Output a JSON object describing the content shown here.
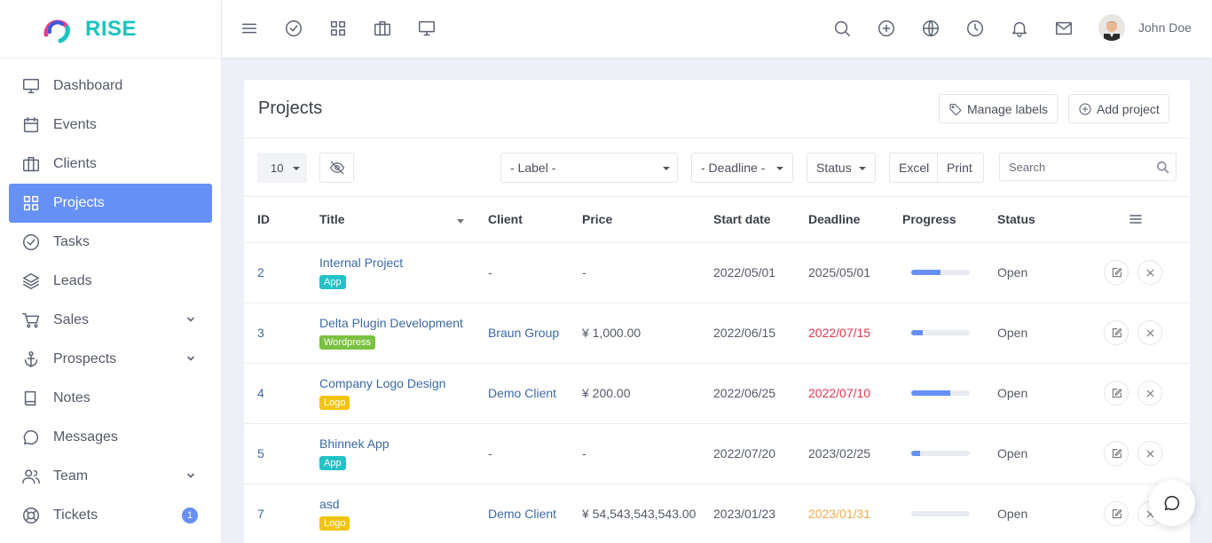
{
  "brand": {
    "name": "RISE"
  },
  "sidebar": {
    "items": [
      {
        "label": "Dashboard",
        "icon": "monitor-icon"
      },
      {
        "label": "Events",
        "icon": "calendar-icon"
      },
      {
        "label": "Clients",
        "icon": "briefcase-icon"
      },
      {
        "label": "Projects",
        "icon": "grid-icon",
        "active": true
      },
      {
        "label": "Tasks",
        "icon": "check-circle-icon"
      },
      {
        "label": "Leads",
        "icon": "layers-icon"
      },
      {
        "label": "Sales",
        "icon": "cart-icon",
        "expandable": true
      },
      {
        "label": "Prospects",
        "icon": "anchor-icon",
        "expandable": true
      },
      {
        "label": "Notes",
        "icon": "book-icon"
      },
      {
        "label": "Messages",
        "icon": "chat-icon"
      },
      {
        "label": "Team",
        "icon": "users-icon",
        "expandable": true
      },
      {
        "label": "Tickets",
        "icon": "lifebuoy-icon",
        "badge": "1"
      }
    ]
  },
  "topbar": {
    "user_name": "John Doe",
    "left_icons": [
      "menu-icon",
      "check-circle-icon",
      "grid-icon",
      "briefcase-icon",
      "monitor-icon"
    ],
    "right_icons": [
      "search-icon",
      "plus-circle-icon",
      "globe-icon",
      "clock-icon",
      "bell-icon",
      "mail-icon"
    ]
  },
  "page": {
    "title": "Projects",
    "manage_labels": "Manage labels",
    "add_project": "Add project"
  },
  "toolbar": {
    "page_size": "10",
    "label_filter": "- Label -",
    "deadline_filter": "- Deadline -",
    "status_filter": "Status",
    "excel": "Excel",
    "print": "Print",
    "search_placeholder": "Search"
  },
  "table": {
    "columns": [
      "ID",
      "Title",
      "Client",
      "Price",
      "Start date",
      "Deadline",
      "Progress",
      "Status"
    ],
    "rows": [
      {
        "id": "2",
        "title": "Internal Project",
        "label": "App",
        "label_color": "#24c2c6",
        "client": "-",
        "price": "-",
        "start": "2022/05/01",
        "deadline": "2025/05/01",
        "deadline_color": "#555a66",
        "progress": 50,
        "status": "Open"
      },
      {
        "id": "3",
        "title": "Delta Plugin Development",
        "label": "Wordpress",
        "label_color": "#7ac142",
        "client": "Braun Group",
        "price": "¥ 1,000.00",
        "start": "2022/06/15",
        "deadline": "2022/07/15",
        "deadline_color": "#e0384f",
        "progress": 20,
        "status": "Open"
      },
      {
        "id": "4",
        "title": "Company Logo Design",
        "label": "Logo",
        "label_color": "#f1c40f",
        "client": "Demo Client",
        "price": "¥ 200.00",
        "start": "2022/06/25",
        "deadline": "2022/07/10",
        "deadline_color": "#e0384f",
        "progress": 67,
        "status": "Open"
      },
      {
        "id": "5",
        "title": "Bhinnek App",
        "label": "App",
        "label_color": "#24c2c6",
        "client": "-",
        "price": "-",
        "start": "2022/07/20",
        "deadline": "2023/02/25",
        "deadline_color": "#555a66",
        "progress": 15,
        "status": "Open"
      },
      {
        "id": "7",
        "title": "asd",
        "label": "Logo",
        "label_color": "#f1c40f",
        "client": "Demo Client",
        "price": "¥ 54,543,543,543.00",
        "start": "2023/01/23",
        "deadline": "2023/01/31",
        "deadline_color": "#f0ad4e",
        "progress": 0,
        "status": "Open"
      }
    ]
  },
  "colors": {
    "accent": "#6690f4",
    "brand": "#19c3c0",
    "link": "#3c6aa5"
  }
}
